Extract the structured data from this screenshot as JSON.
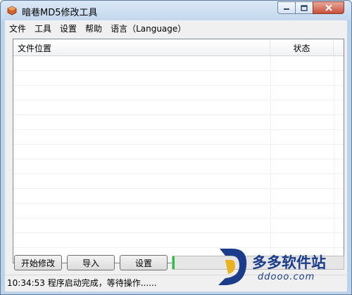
{
  "window": {
    "title": "暗巷MD5修改工具"
  },
  "menu": {
    "items": [
      {
        "label": "文件"
      },
      {
        "label": "工具"
      },
      {
        "label": "设置"
      },
      {
        "label": "帮助"
      },
      {
        "label": "语言（Language）"
      }
    ]
  },
  "list": {
    "columns": [
      "文件位置",
      "状态"
    ],
    "rows": []
  },
  "buttons": {
    "start": "开始修改",
    "import": "导入",
    "settings": "设置"
  },
  "progress": {
    "value": 0.01,
    "color": "#22c83a"
  },
  "status": {
    "text": "10:34:53 程序启动完成，等待操作......"
  },
  "watermark": {
    "brand": "多多软件站",
    "url": "ddooo.com"
  },
  "colors": {
    "title_bar": "#c3d7ee",
    "close_button": "#c8503a",
    "watermark": "#1a3c8a"
  }
}
